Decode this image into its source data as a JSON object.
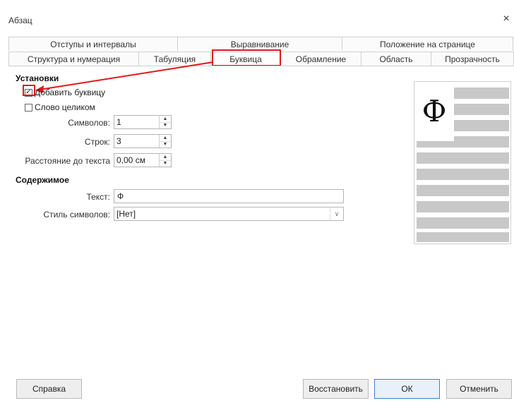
{
  "window": {
    "title": "Абзац",
    "close_glyph": "×"
  },
  "tabs_row1": [
    {
      "label": "Отступы и интервалы"
    },
    {
      "label": "Выравнивание"
    },
    {
      "label": "Положение на странице"
    }
  ],
  "tabs_row2": [
    {
      "label": "Структура и нумерация"
    },
    {
      "label": "Табуляция"
    },
    {
      "label": "Буквица",
      "active": true
    },
    {
      "label": "Обрамление"
    },
    {
      "label": "Область"
    },
    {
      "label": "Прозрачность"
    }
  ],
  "settings": {
    "section_title": "Установки",
    "add_dropcap": {
      "label": "Добавить буквицу",
      "checked": true,
      "mark": "✓"
    },
    "whole_word": {
      "label": "Слово целиком",
      "checked": false
    },
    "chars": {
      "label": "Символов:",
      "value": "1"
    },
    "lines": {
      "label": "Строк:",
      "value": "3"
    },
    "spacing": {
      "label": "Расстояние до текста",
      "value": "0,00 см"
    }
  },
  "contents": {
    "section_title": "Содержимое",
    "text": {
      "label": "Текст:",
      "value": "Ф"
    },
    "char_style": {
      "label": "Стиль символов:",
      "value": "[Нет]"
    }
  },
  "preview": {
    "dropcap_letter": "Ф"
  },
  "buttons": {
    "help": "Справка",
    "reset": "Восстановить",
    "ok": "ОК",
    "cancel": "Отменить"
  },
  "colors": {
    "annotation_red": "#e01919",
    "preview_line": "#c8c8c8",
    "default_button_border": "#3d7fd6"
  },
  "icons": {
    "spin_up": "▲",
    "spin_down": "▼",
    "dropdown": "∨"
  }
}
